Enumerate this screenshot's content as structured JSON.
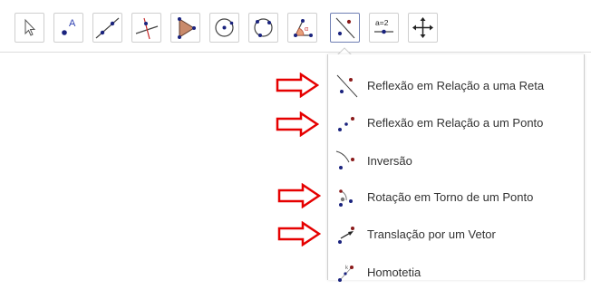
{
  "toolbar": {
    "tools": [
      {
        "name": "move"
      },
      {
        "name": "point",
        "label": "A"
      },
      {
        "name": "line"
      },
      {
        "name": "perpendicular-line"
      },
      {
        "name": "polygon"
      },
      {
        "name": "circle-center-point"
      },
      {
        "name": "circle-three-points"
      },
      {
        "name": "angle"
      },
      {
        "name": "reflect-about-line",
        "selected": true
      },
      {
        "name": "slider",
        "label": "a=2"
      },
      {
        "name": "move-graphics-view"
      }
    ]
  },
  "menu": {
    "items": [
      {
        "label": "Reflexão em Relação a uma Reta",
        "icon": "reflect-line-icon",
        "highlighted": true
      },
      {
        "label": "Reflexão em Relação a um Ponto",
        "icon": "reflect-point-icon",
        "highlighted": true
      },
      {
        "label": "Inversão",
        "icon": "inversion-icon",
        "highlighted": false
      },
      {
        "label": "Rotação em Torno de um Ponto",
        "icon": "rotate-icon",
        "highlighted": true
      },
      {
        "label": "Translação por um Vetor",
        "icon": "translate-vector-icon",
        "highlighted": true
      },
      {
        "label": "Homotetia",
        "icon": "dilate-icon",
        "highlighted": false
      }
    ]
  },
  "colors": {
    "point_blue": "#1a237e",
    "point_red": "#8b1a1a",
    "arrow_red": "#e60000",
    "accent": "#6f7fb3",
    "polygon_fill": "#c98a6b"
  }
}
